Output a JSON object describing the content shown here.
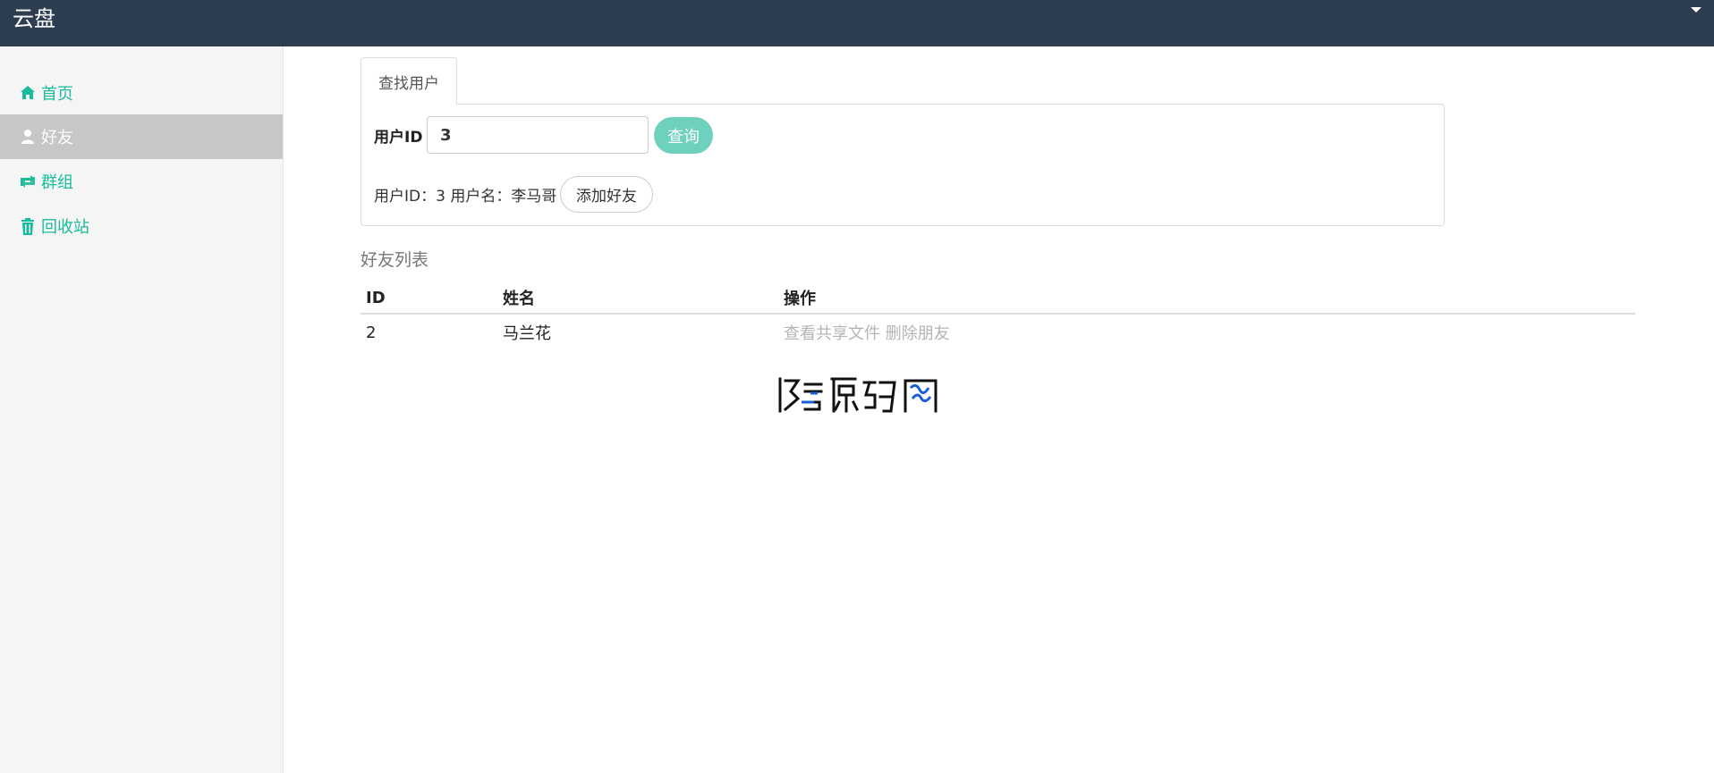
{
  "header": {
    "brand": "云盘"
  },
  "sidebar": {
    "items": [
      {
        "label": "首页",
        "icon": "home-icon",
        "active": false
      },
      {
        "label": "好友",
        "icon": "user-icon",
        "active": true
      },
      {
        "label": "群组",
        "icon": "retweet-icon",
        "active": false
      },
      {
        "label": "回收站",
        "icon": "trash-icon",
        "active": false
      }
    ]
  },
  "search": {
    "tab_label": "查找用户",
    "field_label": "用户ID",
    "input_value": "3",
    "query_button": "查询",
    "result_text": "用户ID：3 用户名：李马哥",
    "add_friend_button": "添加好友"
  },
  "friends": {
    "title": "好友列表",
    "headers": [
      "ID",
      "姓名",
      "操作"
    ],
    "rows": [
      {
        "id": "2",
        "name": "马兰花",
        "actions": [
          "查看共享文件",
          "删除朋友"
        ]
      }
    ]
  },
  "colors": {
    "navbar": "#2c3e50",
    "accent": "#18bc9c",
    "active_item": "#c6c7c8",
    "query_button": "#6ed1bd"
  }
}
